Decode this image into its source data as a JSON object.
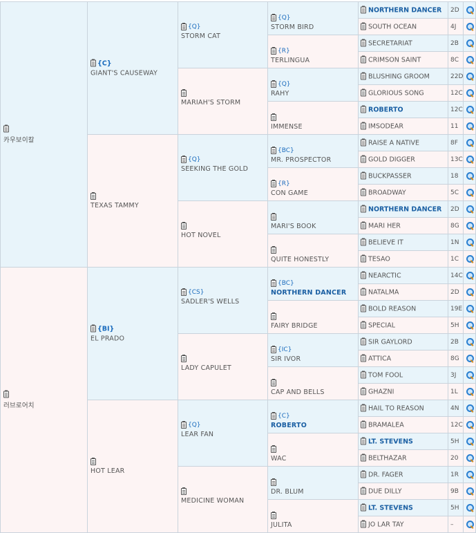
{
  "gen1": [
    {
      "name": "카우보이칼",
      "tag": ""
    },
    {
      "name": "러브로어치",
      "tag": ""
    }
  ],
  "gen2": [
    {
      "name": "GIANT'S CAUSEWAY",
      "tag": "{C}"
    },
    {
      "name": "TEXAS TAMMY",
      "tag": ""
    },
    {
      "name": "EL PRADO",
      "tag": "{BI}"
    },
    {
      "name": "HOT LEAR",
      "tag": ""
    }
  ],
  "gen3": [
    {
      "name": "STORM CAT",
      "tag": "{Q}"
    },
    {
      "name": "MARIAH'S STORM",
      "tag": ""
    },
    {
      "name": "SEEKING THE GOLD",
      "tag": "{Q}"
    },
    {
      "name": "HOT NOVEL",
      "tag": ""
    },
    {
      "name": "SADLER'S WELLS",
      "tag": "{CS}"
    },
    {
      "name": "LADY CAPULET",
      "tag": ""
    },
    {
      "name": "LEAR FAN",
      "tag": "{Q}"
    },
    {
      "name": "MEDICINE WOMAN",
      "tag": ""
    }
  ],
  "gen4": [
    {
      "name": "STORM BIRD",
      "tag": "{Q}"
    },
    {
      "name": "TERLINGUA",
      "tag": "{R}"
    },
    {
      "name": "RAHY",
      "tag": "{Q}"
    },
    {
      "name": "IMMENSE",
      "tag": ""
    },
    {
      "name": "MR. PROSPECTOR",
      "tag": "{BC}"
    },
    {
      "name": "CON GAME",
      "tag": "{R}"
    },
    {
      "name": "MARI'S BOOK",
      "tag": ""
    },
    {
      "name": "QUITE HONESTLY",
      "tag": ""
    },
    {
      "name": "NORTHERN DANCER",
      "tag": "{BC}",
      "bold": true
    },
    {
      "name": "FAIRY BRIDGE",
      "tag": ""
    },
    {
      "name": "SIR IVOR",
      "tag": "{IC}"
    },
    {
      "name": "CAP AND BELLS",
      "tag": ""
    },
    {
      "name": "ROBERTO",
      "tag": "{C}",
      "bold": true
    },
    {
      "name": "WAC",
      "tag": ""
    },
    {
      "name": "DR. BLUM",
      "tag": ""
    },
    {
      "name": "JULITA",
      "tag": ""
    }
  ],
  "gen5": [
    {
      "name": "NORTHERN DANCER",
      "code": "2D",
      "bold": true
    },
    {
      "name": "SOUTH OCEAN",
      "code": "4J"
    },
    {
      "name": "SECRETARIAT",
      "code": "2B"
    },
    {
      "name": "CRIMSON SAINT",
      "code": "8C"
    },
    {
      "name": "BLUSHING GROOM",
      "code": "22D"
    },
    {
      "name": "GLORIOUS SONG",
      "code": "12C"
    },
    {
      "name": "ROBERTO",
      "code": "12C",
      "bold": true
    },
    {
      "name": "IMSODEAR",
      "code": "11"
    },
    {
      "name": "RAISE A NATIVE",
      "code": "8F"
    },
    {
      "name": "GOLD DIGGER",
      "code": "13C"
    },
    {
      "name": "BUCKPASSER",
      "code": "18"
    },
    {
      "name": "BROADWAY",
      "code": "5C"
    },
    {
      "name": "NORTHERN DANCER",
      "code": "2D",
      "bold": true
    },
    {
      "name": "MARI HER",
      "code": "8G"
    },
    {
      "name": "BELIEVE IT",
      "code": "1N"
    },
    {
      "name": "TESAO",
      "code": "1C"
    },
    {
      "name": "NEARCTIC",
      "code": "14C"
    },
    {
      "name": "NATALMA",
      "code": "2D"
    },
    {
      "name": "BOLD REASON",
      "code": "19E"
    },
    {
      "name": "SPECIAL",
      "code": "5H"
    },
    {
      "name": "SIR GAYLORD",
      "code": "2B"
    },
    {
      "name": "ATTICA",
      "code": "8G"
    },
    {
      "name": "TOM FOOL",
      "code": "3J"
    },
    {
      "name": "GHAZNI",
      "code": "1L"
    },
    {
      "name": "HAIL TO REASON",
      "code": "4N"
    },
    {
      "name": "BRAMALEA",
      "code": "12C"
    },
    {
      "name": "LT. STEVENS",
      "code": "5H",
      "bold": true
    },
    {
      "name": "BELTHAZAR",
      "code": "20"
    },
    {
      "name": "DR. FAGER",
      "code": "1R"
    },
    {
      "name": "DUE DILLY",
      "code": "9B"
    },
    {
      "name": "LT. STEVENS",
      "code": "5H",
      "bold": true
    },
    {
      "name": "JO LAR TAY",
      "code": "–"
    }
  ],
  "icons": {
    "clipboard": "clipboard-icon",
    "search": "magnifier-icon"
  }
}
